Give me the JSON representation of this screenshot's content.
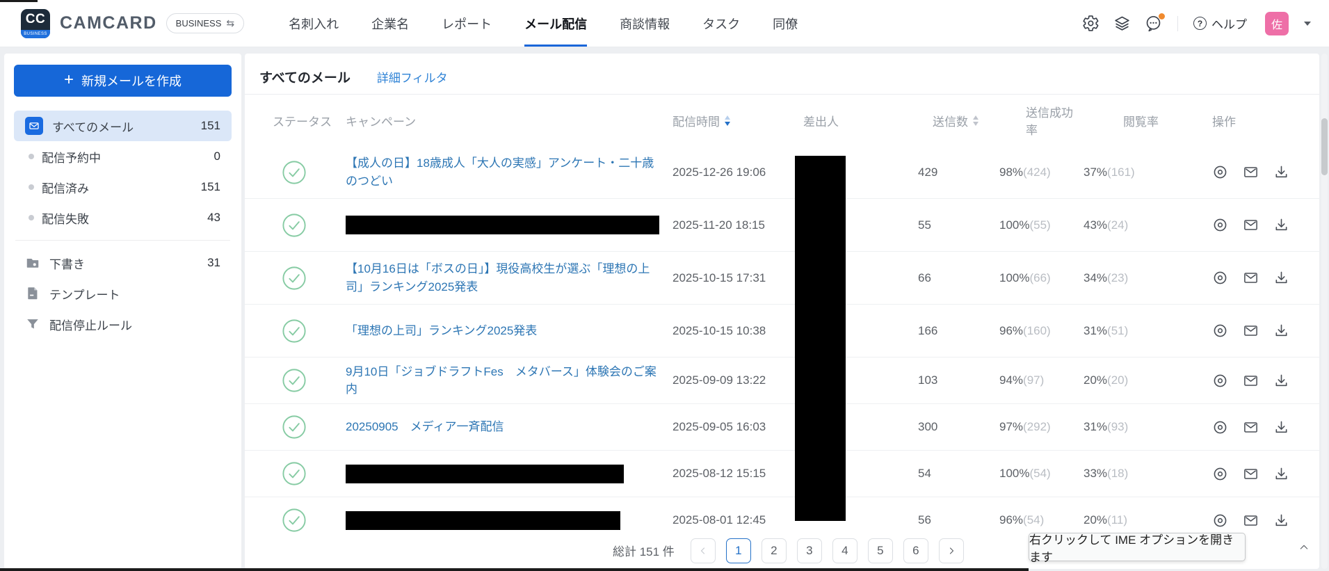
{
  "topbar": {
    "logo_text": "CC",
    "logo_sub": "BUSINESS",
    "brand": "CAMCARD",
    "plan_badge": "BUSINESS",
    "plan_badge_icon": "⇆",
    "nav": [
      {
        "label": "名刺入れ",
        "active": false
      },
      {
        "label": "企業名",
        "active": false
      },
      {
        "label": "レポート",
        "active": false
      },
      {
        "label": "メール配信",
        "active": true
      },
      {
        "label": "商談情報",
        "active": false
      },
      {
        "label": "タスク",
        "active": false
      },
      {
        "label": "同僚",
        "active": false
      }
    ],
    "help_label": "ヘルプ",
    "avatar_text": "佐"
  },
  "sidebar": {
    "compose_button": "新規メールを作成",
    "items": [
      {
        "label": "すべてのメール",
        "count": "151",
        "icon": "mail",
        "active": true,
        "section": 1
      },
      {
        "label": "配信予約中",
        "count": "0",
        "icon": "dot",
        "active": false,
        "section": 1
      },
      {
        "label": "配信済み",
        "count": "151",
        "icon": "dot",
        "active": false,
        "section": 1
      },
      {
        "label": "配信失敗",
        "count": "43",
        "icon": "dot",
        "active": false,
        "section": 1
      },
      {
        "label": "下書き",
        "count": "31",
        "icon": "folder",
        "active": false,
        "section": 2
      },
      {
        "label": "テンプレート",
        "count": "",
        "icon": "file",
        "active": false,
        "section": 2
      },
      {
        "label": "配信停止ルール",
        "count": "",
        "icon": "filter",
        "active": false,
        "section": 2
      }
    ]
  },
  "main": {
    "title": "すべてのメール",
    "filter_link": "詳細フィルタ",
    "columns": [
      {
        "label": "ステータス",
        "sort": null
      },
      {
        "label": "キャンペーン",
        "sort": null
      },
      {
        "label": "配信時間",
        "sort": "desc"
      },
      {
        "label": "差出人",
        "sort": null
      },
      {
        "label": "送信数",
        "sort": "none"
      },
      {
        "label": "送信成功率",
        "sort": null
      },
      {
        "label": "閲覧率",
        "sort": null
      },
      {
        "label": "操作",
        "sort": null
      }
    ],
    "rows": [
      {
        "status": "success",
        "campaign": "【成人の日】18歳成人「大人の実感」アンケート・二十歳のつどい",
        "redacted": false,
        "redact_width": 0,
        "time": "2025-12-26 19:06",
        "sent": "429",
        "success_pct": "98%",
        "success_cnt": "(424)",
        "open_pct": "37%",
        "open_cnt": "(161)"
      },
      {
        "status": "success",
        "campaign": "",
        "redacted": true,
        "redact_width": 451,
        "time": "2025-11-20 18:15",
        "sent": "55",
        "success_pct": "100%",
        "success_cnt": "(55)",
        "open_pct": "43%",
        "open_cnt": "(24)"
      },
      {
        "status": "success",
        "campaign": "【10月16日は「ボスの日」】現役高校生が選ぶ「理想の上司」ランキング2025発表",
        "redacted": false,
        "redact_width": 0,
        "time": "2025-10-15 17:31",
        "sent": "66",
        "success_pct": "100%",
        "success_cnt": "(66)",
        "open_pct": "34%",
        "open_cnt": "(23)"
      },
      {
        "status": "success",
        "campaign": "「理想の上司」ランキング2025発表",
        "redacted": false,
        "redact_width": 0,
        "time": "2025-10-15 10:38",
        "sent": "166",
        "success_pct": "96%",
        "success_cnt": "(160)",
        "open_pct": "31%",
        "open_cnt": "(51)"
      },
      {
        "status": "success",
        "campaign": "9月10日「ジョブドラフトFes　メタバース」体験会のご案内",
        "redacted": false,
        "redact_width": 0,
        "time": "2025-09-09 13:22",
        "sent": "103",
        "success_pct": "94%",
        "success_cnt": "(97)",
        "open_pct": "20%",
        "open_cnt": "(20)"
      },
      {
        "status": "success",
        "campaign": "20250905　メディア一斉配信",
        "redacted": false,
        "redact_width": 0,
        "time": "2025-09-05 16:03",
        "sent": "300",
        "success_pct": "97%",
        "success_cnt": "(292)",
        "open_pct": "31%",
        "open_cnt": "(93)"
      },
      {
        "status": "success",
        "campaign": "",
        "redacted": true,
        "redact_width": 400,
        "time": "2025-08-12 15:15",
        "sent": "54",
        "success_pct": "100%",
        "success_cnt": "(54)",
        "open_pct": "33%",
        "open_cnt": "(18)"
      },
      {
        "status": "success",
        "campaign": "",
        "redacted": true,
        "redact_width": 395,
        "time": "2025-08-01 12:45",
        "sent": "56",
        "success_pct": "96%",
        "success_cnt": "(54)",
        "open_pct": "20%",
        "open_cnt": "(11)"
      }
    ],
    "pagination": {
      "total_label": "総計 151 件",
      "pages": [
        "1",
        "2",
        "3",
        "4",
        "5",
        "6"
      ],
      "current_page": "1",
      "prev_disabled": true
    }
  },
  "overlay": {
    "ime_tooltip": "右クリックして IME オプションを開きます"
  },
  "colors": {
    "accent_blue": "#1667d8",
    "link_blue": "#2d76b4",
    "filter_link_blue": "#2f83d6",
    "success_green": "#86cba3",
    "avatar_pink": "#ee6fa7",
    "notification_orange": "#f08a2e"
  }
}
